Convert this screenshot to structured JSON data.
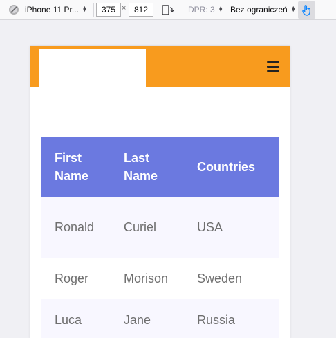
{
  "toolbar": {
    "device": "iPhone 11 Pr...",
    "width": "375",
    "times": "×",
    "height": "812",
    "dpr": "DPR: 3",
    "throttling": "Bez ograniczeń"
  },
  "table": {
    "headers": [
      "First Name",
      "Last Name",
      "Countries"
    ],
    "rows": [
      [
        "Ronald",
        "Curiel",
        "USA"
      ],
      [
        "Roger",
        "Morison",
        "Sweden"
      ],
      [
        "Luca",
        "Jane",
        "Russia"
      ]
    ]
  },
  "colors": {
    "header_bg": "#f89b1e",
    "table_head_bg": "#6b79e0",
    "row_alt_bg": "#f8f7ff"
  },
  "icons": [
    "block-icon",
    "rotate-device-icon",
    "touch-icon",
    "hamburger-icon"
  ]
}
